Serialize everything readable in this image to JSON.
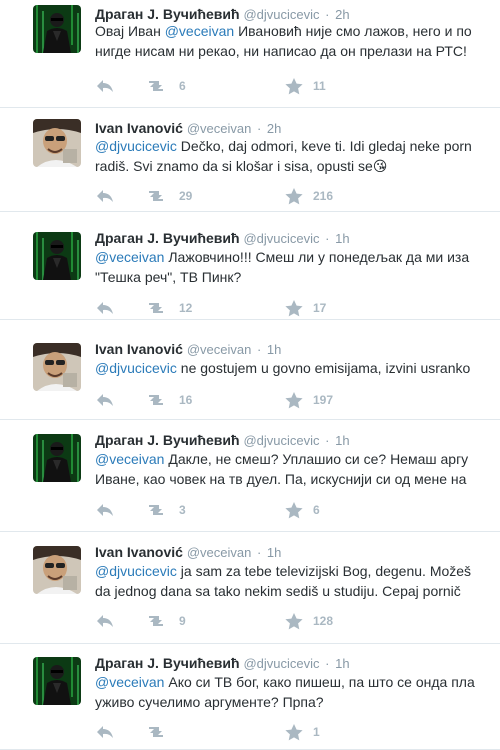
{
  "tweets": [
    {
      "name": "Драган J. Вучићевић",
      "handle": "@djvucicevic",
      "time": "2h",
      "mention": "",
      "line1": "Овај Иван @veceivan Ивановић није смо лажов, него и по",
      "line2": "нигде нисам ни рекао, ни написао да он прелази на РТС!",
      "retweets": "6",
      "favorites": "11",
      "avatar": "matrix"
    },
    {
      "name": "Ivan Ivanović",
      "handle": "@veceivan",
      "time": "2h",
      "mention": "@djvucicevic",
      "line1": " Dečko, daj odmori, keve ti. Idi gledaj neke porn",
      "line2": "radiš. Svi znamo da si klošar i sisa, opusti se😘",
      "retweets": "29",
      "favorites": "216",
      "avatar": "man"
    },
    {
      "name": "Драган J. Вучићевић",
      "handle": "@djvucicevic",
      "time": "1h",
      "mention": "@veceivan",
      "line1": " Лажовчино!!! Смеш ли у понедељак да ми иза",
      "line2": "\"Тешка реч\", ТВ Пинк?",
      "retweets": "12",
      "favorites": "17",
      "avatar": "matrix"
    },
    {
      "name": "Ivan Ivanović",
      "handle": "@veceivan",
      "time": "1h",
      "mention": "@djvucicevic",
      "line1": " ne gostujem u govno emisijama, izvini usranko",
      "line2": "",
      "retweets": "16",
      "favorites": "197",
      "avatar": "man"
    },
    {
      "name": "Драган J. Вучићевић",
      "handle": "@djvucicevic",
      "time": "1h",
      "mention": "@veceivan",
      "line1": " Дакле, не смеш? Уплашио си се? Немаш аргу",
      "line2": "Иване, као човек на тв дуел. Па, искуснији си од мене на",
      "retweets": "3",
      "favorites": "6",
      "avatar": "matrix"
    },
    {
      "name": "Ivan Ivanović",
      "handle": "@veceivan",
      "time": "1h",
      "mention": "@djvucicevic",
      "line1": " ja sam za tebe televizijski Bog, degenu. Možeš",
      "line2": "da jednog dana sa tako nekim sediš u studiju. Cepaj pornič",
      "retweets": "9",
      "favorites": "128",
      "avatar": "man"
    },
    {
      "name": "Драган J. Вучићевић",
      "handle": "@djvucicevic",
      "time": "1h",
      "mention": "@veceivan",
      "line1": " Ако си ТВ бог, како пишеш, па што се онда пла",
      "line2": "уживо сучелимо аргументе? Прпа?",
      "retweets": "",
      "favorites": "1",
      "avatar": "matrix"
    }
  ],
  "colors": {
    "text": "#292f33",
    "meta": "#8899a6",
    "mention": "#2b7bb9",
    "action": "#aab8c2",
    "divider": "#e1e8ed"
  },
  "icons": [
    "reply-icon",
    "retweet-icon",
    "favorite-star-icon"
  ]
}
